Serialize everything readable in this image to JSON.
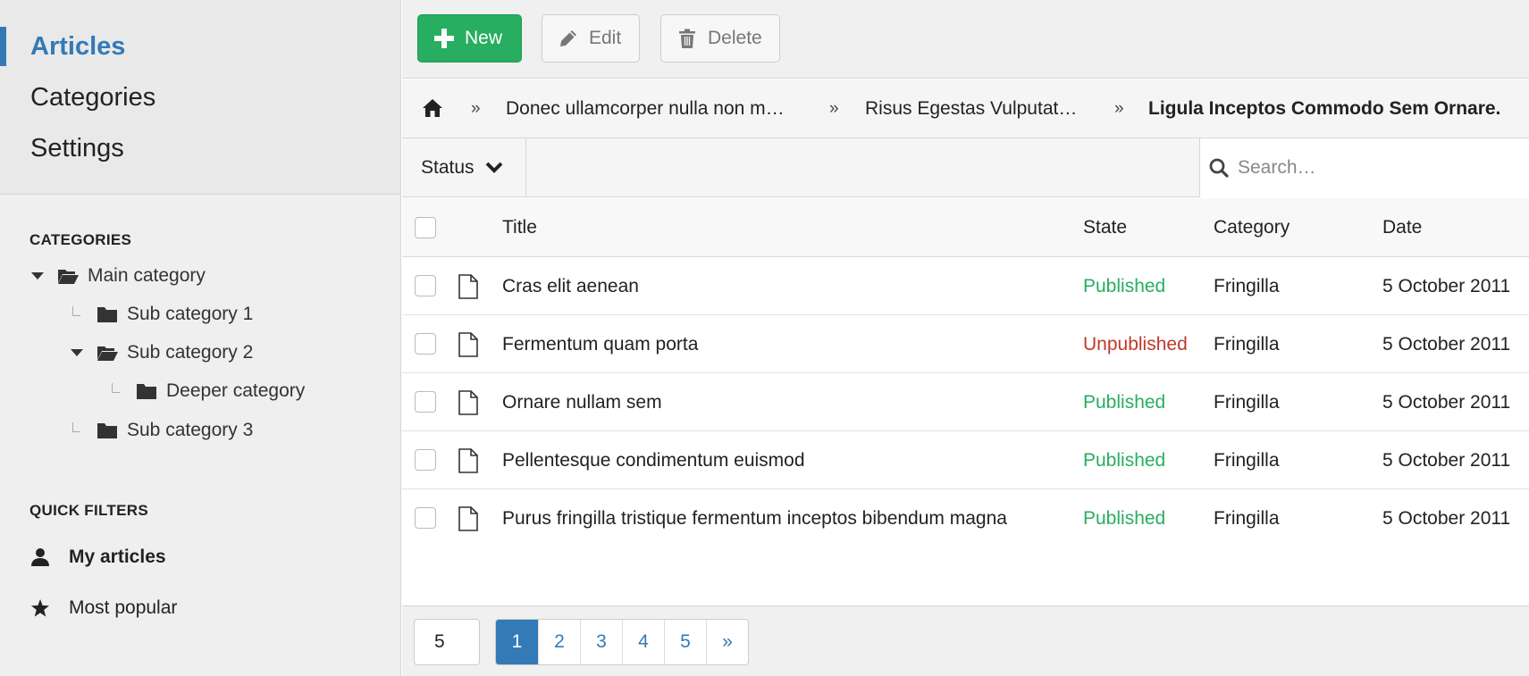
{
  "sidebar": {
    "nav": [
      {
        "label": "Articles",
        "active": true
      },
      {
        "label": "Categories",
        "active": false
      },
      {
        "label": "Settings",
        "active": false
      }
    ],
    "categories_title": "CATEGORIES",
    "tree": [
      {
        "label": "Main category",
        "state": "expanded"
      },
      {
        "label": "Sub category 1",
        "state": "leaf"
      },
      {
        "label": "Sub category 2",
        "state": "expanded"
      },
      {
        "label": "Deeper category",
        "state": "leaf"
      },
      {
        "label": "Sub category 3",
        "state": "leaf"
      }
    ],
    "quick_filters_title": "QUICK FILTERS",
    "quick_filters": [
      {
        "label": "My articles",
        "icon": "user-icon"
      },
      {
        "label": "Most popular",
        "icon": "star-icon"
      }
    ]
  },
  "toolbar": {
    "new_label": "New",
    "edit_label": "Edit",
    "delete_label": "Delete"
  },
  "breadcrumb": {
    "home_icon": "home-icon",
    "separator": "»",
    "items": [
      "Donec ullamcorper nulla non m…",
      "Risus Egestas Vulputat…",
      "Ligula Inceptos Commodo Sem Ornare."
    ]
  },
  "filters": {
    "status_label": "Status",
    "search_placeholder": "Search…"
  },
  "table": {
    "columns": [
      "Title",
      "State",
      "Category",
      "Date"
    ],
    "rows": [
      {
        "title": "Cras elit aenean",
        "state": "Published",
        "category": "Fringilla",
        "date": "5 October 2011"
      },
      {
        "title": "Fermentum quam porta",
        "state": "Unpublished",
        "category": "Fringilla",
        "date": "5 October 2011"
      },
      {
        "title": "Ornare nullam sem",
        "state": "Published",
        "category": "Fringilla",
        "date": "5 October 2011"
      },
      {
        "title": "Pellentesque condimentum euismod",
        "state": "Published",
        "category": "Fringilla",
        "date": "5 October 2011"
      },
      {
        "title": "Purus fringilla tristique fermentum inceptos bibendum magna",
        "state": "Published",
        "category": "Fringilla",
        "date": "5 October 2011"
      }
    ]
  },
  "pager": {
    "per_page": "5",
    "pages": [
      "1",
      "2",
      "3",
      "4",
      "5"
    ],
    "next_label": "»",
    "current_page": "1"
  },
  "colors": {
    "accent": "#337ab7",
    "new_button": "#27ae60",
    "published": "#27ae60",
    "unpublished": "#c0392b"
  }
}
